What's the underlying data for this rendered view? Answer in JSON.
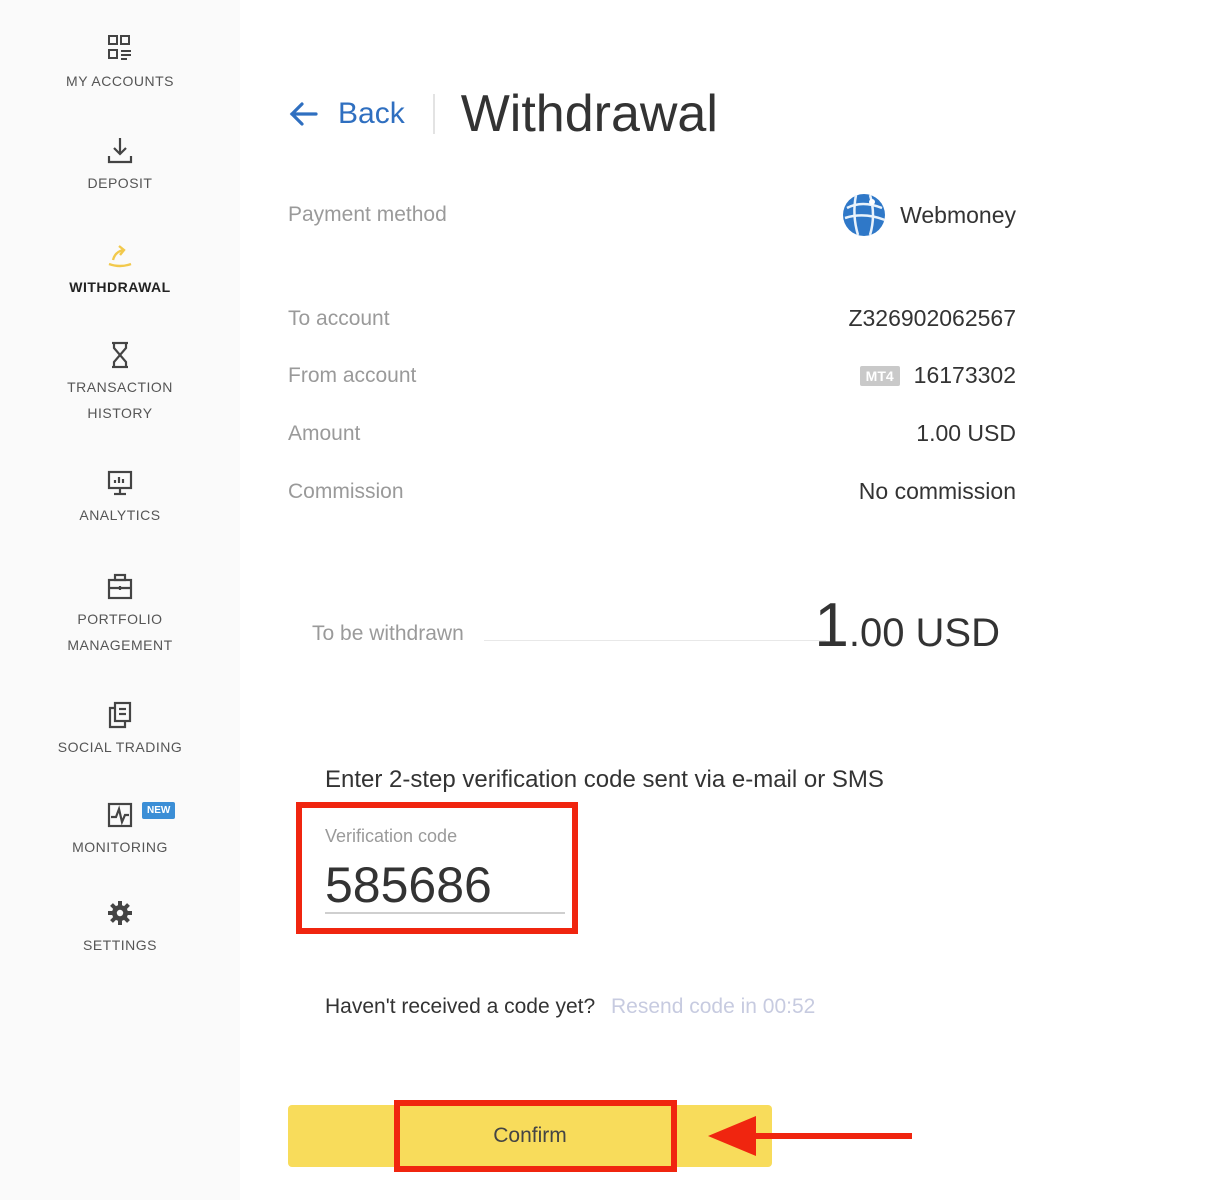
{
  "sidebar": {
    "items": [
      {
        "label": "MY ACCOUNTS",
        "icon": "accounts-grid-icon"
      },
      {
        "label": "DEPOSIT",
        "icon": "download-icon"
      },
      {
        "label": "WITHDRAWAL",
        "icon": "withdrawal-icon",
        "active": true
      },
      {
        "label_line1": "TRANSACTION",
        "label_line2": "HISTORY",
        "icon": "hourglass-icon"
      },
      {
        "label": "ANALYTICS",
        "icon": "analytics-monitor-icon"
      },
      {
        "label_line1": "PORTFOLIO",
        "label_line2": "MANAGEMENT",
        "icon": "briefcase-icon"
      },
      {
        "label": "SOCIAL TRADING",
        "icon": "copy-pages-icon"
      },
      {
        "label": "MONITORING",
        "icon": "pulse-icon",
        "badge": "NEW"
      },
      {
        "label": "SETTINGS",
        "icon": "gear-icon"
      }
    ]
  },
  "header": {
    "back_label": "Back",
    "title": "Withdrawal"
  },
  "details": {
    "payment_method_label": "Payment method",
    "payment_method_value": "Webmoney",
    "to_account_label": "To account",
    "to_account_value": "Z326902062567",
    "from_account_label": "From account",
    "from_account_badge": "MT4",
    "from_account_value": "16173302",
    "amount_label": "Amount",
    "amount_value": "1.00 USD",
    "commission_label": "Commission",
    "commission_value": "No commission"
  },
  "withdrawn": {
    "label": "To be withdrawn",
    "amount_major": "1",
    "amount_rest": ".00 USD"
  },
  "verification": {
    "instruction": "Enter 2-step verification code sent via e-mail or SMS",
    "field_label": "Verification code",
    "code_value": "585686",
    "resend_question": "Haven't received a code yet?",
    "resend_timer": "Resend code in 00:52"
  },
  "confirm_label": "Confirm",
  "colors": {
    "accent_blue": "#2f6fc0",
    "confirm_yellow": "#f8dc5b",
    "annotation_red": "#f0250f",
    "withdrawal_icon": "#f2c94c"
  }
}
